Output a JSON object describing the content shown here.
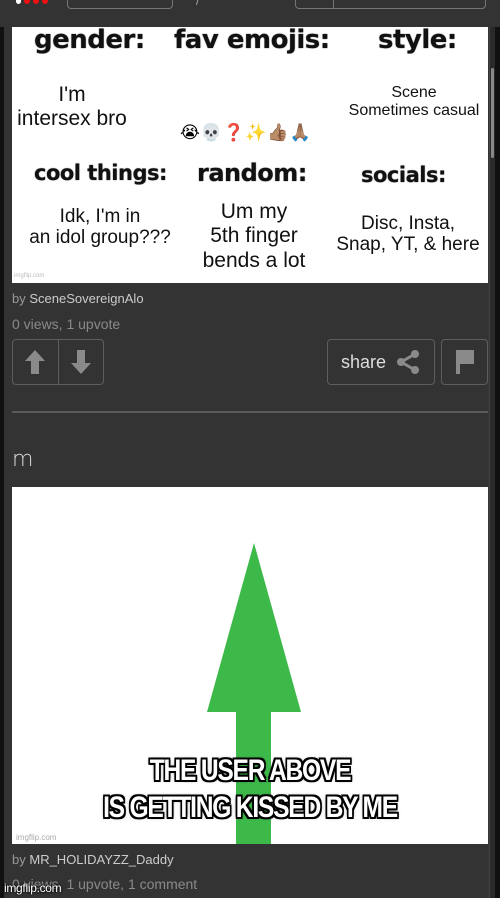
{
  "topbar": {
    "logo": "imgflip-logo"
  },
  "post1": {
    "meme": {
      "headers": {
        "gender": "gender:",
        "fav_emojis": "fav emojis:",
        "style": "style:",
        "cool_things": "cool things:",
        "random": "random:",
        "socials": "socials:"
      },
      "values": {
        "gender": [
          "I'm",
          "intersex bro"
        ],
        "fav_emojis": "😭💀❓✨👍🏽🙏🏽",
        "style": [
          "Scene",
          "Sometimes casual"
        ],
        "cool_things": [
          "Idk, I'm in",
          "an idol group???"
        ],
        "random": [
          "Um my",
          "5th finger",
          "bends a lot"
        ],
        "socials": [
          "Disc, Insta,",
          "Snap, YT, & here"
        ]
      },
      "watermark": "imgflip.com"
    },
    "by_prefix": "by",
    "author": "SceneSovereignAlo",
    "stats": "0 views, 1 upvote",
    "share_label": "share"
  },
  "post2": {
    "title": "m",
    "meme": {
      "caption_line1": "THE USER ABOVE",
      "caption_line2": "IS GETTING KISSED BY ME",
      "arrow_color": "#3db94a",
      "watermark": "imgflip.com"
    },
    "by_prefix": "by",
    "author": "MR_HOLIDAYZZ_Daddy",
    "stats": "0 views, 1 upvote, 1 comment"
  },
  "overlay_watermark": "imgflip.com"
}
